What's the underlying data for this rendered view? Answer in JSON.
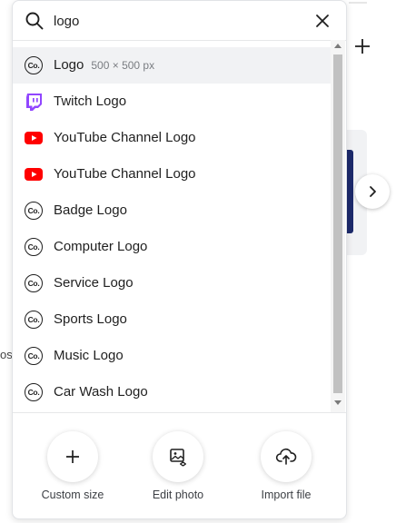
{
  "search": {
    "value": "logo",
    "placeholder": ""
  },
  "results": [
    {
      "label": "Logo",
      "meta": "500 × 500 px",
      "icon": "canva-co-icon",
      "active": true
    },
    {
      "label": "Twitch Logo",
      "meta": "",
      "icon": "twitch-icon"
    },
    {
      "label": "YouTube Channel Logo",
      "meta": "",
      "icon": "youtube-icon"
    },
    {
      "label": "YouTube Channel Logo",
      "meta": "",
      "icon": "youtube-icon"
    },
    {
      "label": "Badge Logo",
      "meta": "",
      "icon": "canva-co-icon"
    },
    {
      "label": "Computer Logo",
      "meta": "",
      "icon": "canva-co-icon"
    },
    {
      "label": "Service Logo",
      "meta": "",
      "icon": "canva-co-icon"
    },
    {
      "label": "Sports Logo",
      "meta": "",
      "icon": "canva-co-icon"
    },
    {
      "label": "Music Logo",
      "meta": "",
      "icon": "canva-co-icon"
    },
    {
      "label": "Car Wash Logo",
      "meta": "",
      "icon": "canva-co-icon"
    }
  ],
  "co_text": "Co.",
  "actions": [
    {
      "label": "Custom size",
      "icon": "plus-icon"
    },
    {
      "label": "Edit photo",
      "icon": "image-edit-icon"
    },
    {
      "label": "Import file",
      "icon": "cloud-upload-icon"
    }
  ],
  "background": {
    "partial_text": "os"
  },
  "colors": {
    "twitch": "#9146ff",
    "youtube": "#ff0000",
    "active_row": "#f1f2f4"
  }
}
